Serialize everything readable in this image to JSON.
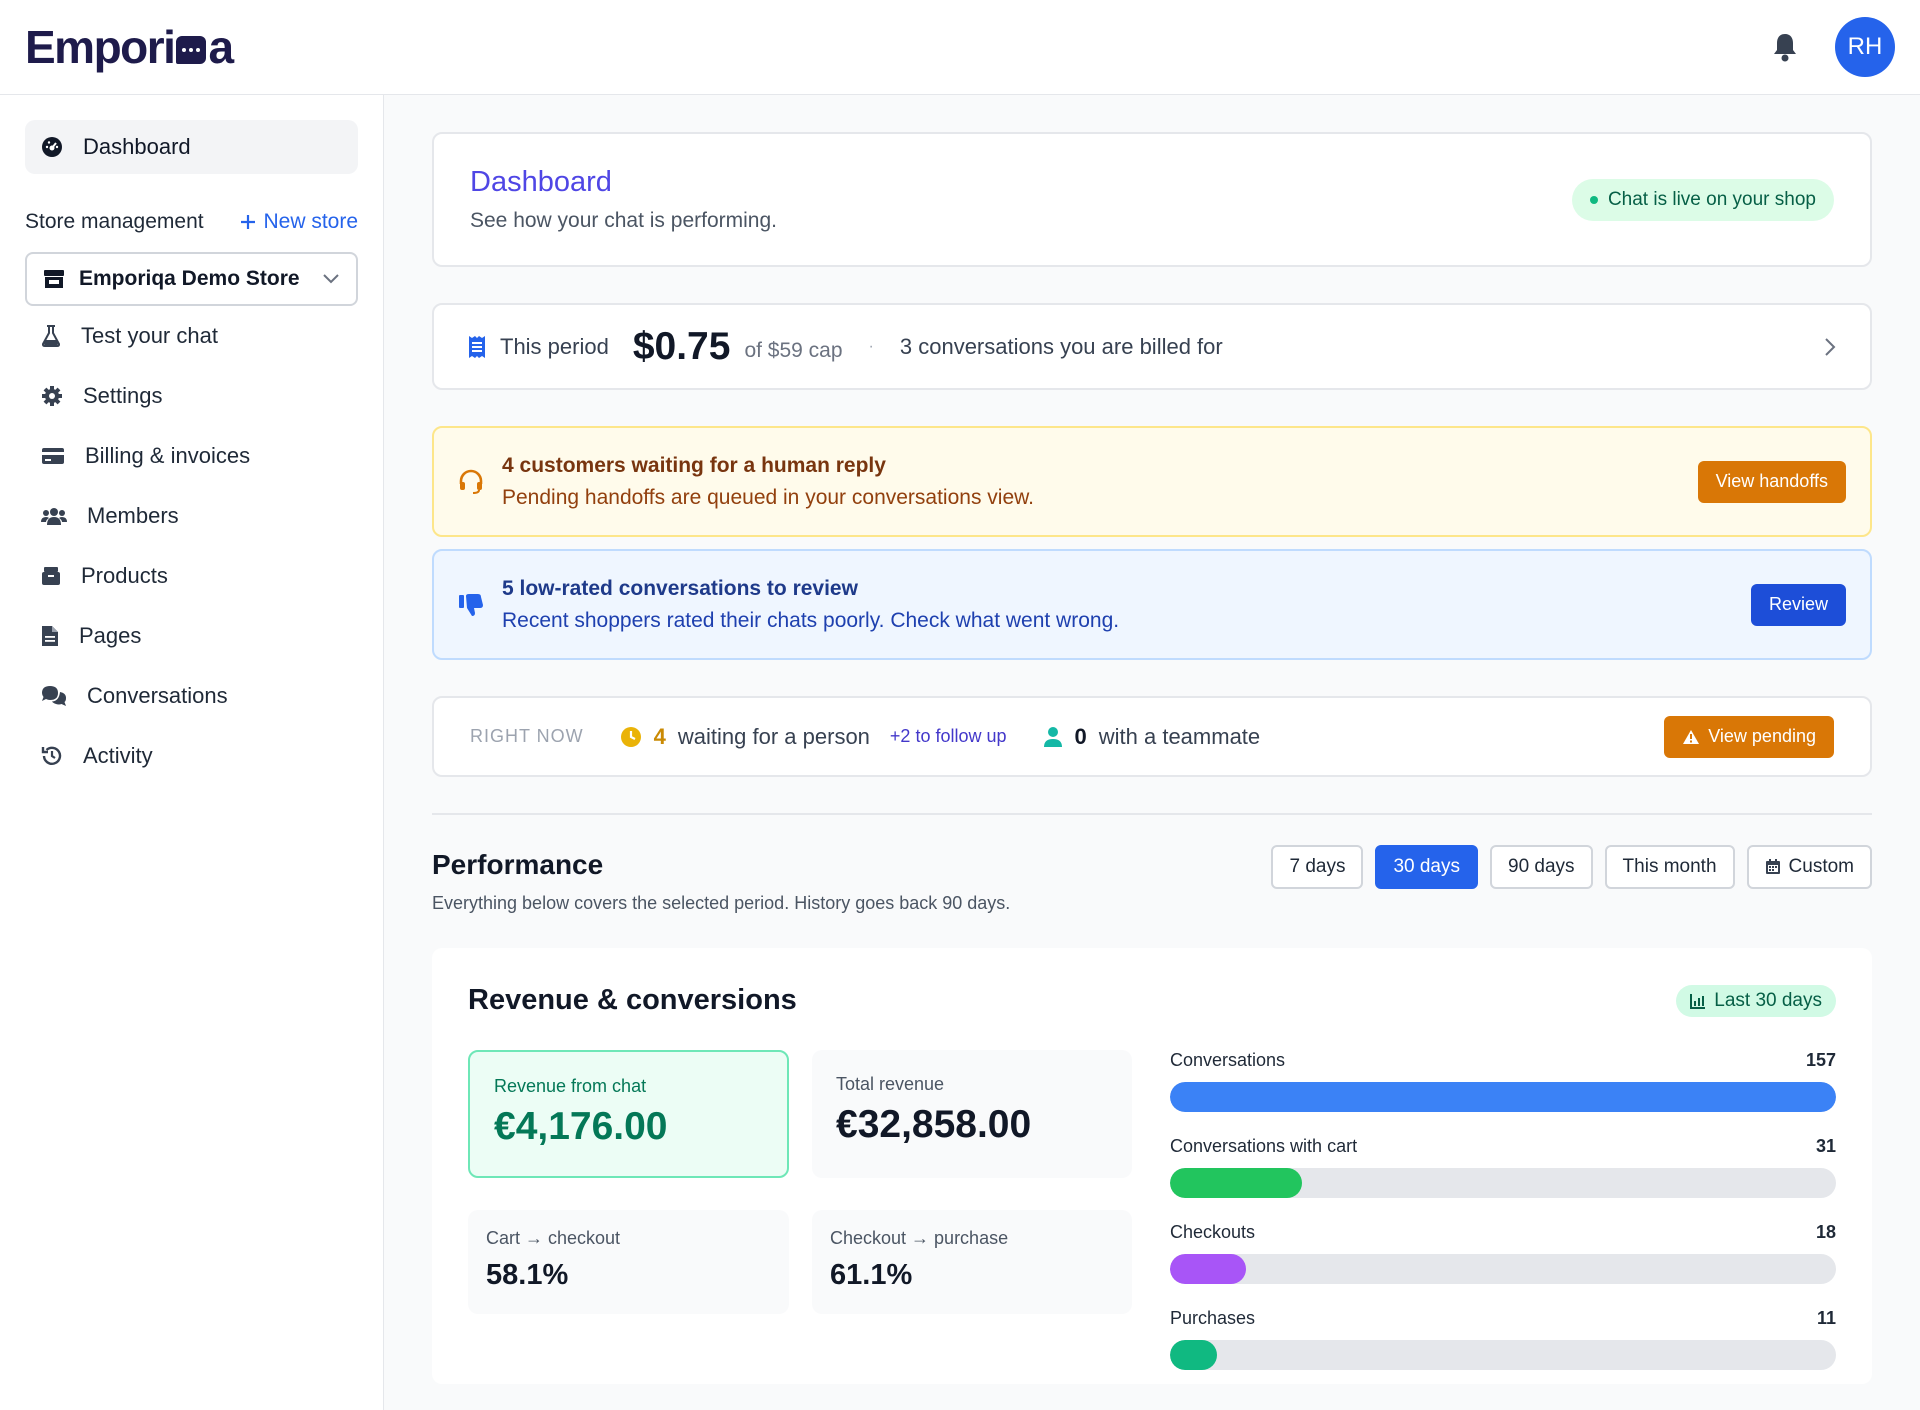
{
  "header": {
    "logo_left": "Empori",
    "logo_right": "a",
    "avatar_initials": "RH"
  },
  "sidebar": {
    "active_item": "Dashboard",
    "store_management_label": "Store management",
    "new_store_label": "New store",
    "store_selected": "Emporiqa Demo Store",
    "items": [
      {
        "label": "Test your chat",
        "icon": "flask-icon"
      },
      {
        "label": "Settings",
        "icon": "gear-icon"
      },
      {
        "label": "Billing & invoices",
        "icon": "credit-card-icon"
      },
      {
        "label": "Members",
        "icon": "users-icon"
      },
      {
        "label": "Products",
        "icon": "box-icon"
      },
      {
        "label": "Pages",
        "icon": "file-icon"
      },
      {
        "label": "Conversations",
        "icon": "comments-icon"
      },
      {
        "label": "Activity",
        "icon": "history-icon"
      }
    ]
  },
  "hero": {
    "title": "Dashboard",
    "subtitle": "See how your chat is performing.",
    "status": "Chat is live on your shop"
  },
  "billing": {
    "label": "This period",
    "amount": "$0.75",
    "cap": "of $59 cap",
    "separator": "·",
    "conversations": "3 conversations you are billed for"
  },
  "alerts": {
    "handoffs": {
      "title": "4 customers waiting for a human reply",
      "subtitle": "Pending handoffs are queued in your conversations view.",
      "button": "View handoffs"
    },
    "low_rated": {
      "title": "5 low-rated conversations to review",
      "subtitle": "Recent shoppers rated their chats poorly. Check what went wrong.",
      "button": "Review"
    }
  },
  "right_now": {
    "label": "RIGHT NOW",
    "waiting_count": "4",
    "waiting_text": "waiting for a person",
    "follow_up": "+2 to follow up",
    "teammate_count": "0",
    "teammate_text": "with a teammate",
    "button": "View pending"
  },
  "performance": {
    "title": "Performance",
    "subtitle": "Everything below covers the selected period. History goes back 90 days.",
    "ranges": [
      "7 days",
      "30 days",
      "90 days",
      "This month",
      "Custom"
    ],
    "active_range": "30 days"
  },
  "revenue": {
    "title": "Revenue & conversions",
    "period": "Last 30 days",
    "revenue_from_chat_label": "Revenue from chat",
    "revenue_from_chat": "€4,176.00",
    "total_revenue_label": "Total revenue",
    "total_revenue": "€32,858.00",
    "cart_checkout_label": "Cart → checkout",
    "cart_checkout": "58.1%",
    "checkout_purchase_label": "Checkout → purchase",
    "checkout_purchase": "61.1%"
  },
  "funnel": [
    {
      "label": "Conversations",
      "value": "157",
      "count": 157,
      "color": "#3b82f6"
    },
    {
      "label": "Conversations with cart",
      "value": "31",
      "count": 31,
      "color": "#22c55e"
    },
    {
      "label": "Checkouts",
      "value": "18",
      "count": 18,
      "color": "#a855f7"
    },
    {
      "label": "Purchases",
      "value": "11",
      "count": 11,
      "color": "#10b981"
    }
  ],
  "colors": {
    "accent": "#2563eb",
    "brand": "#1e1b4b",
    "warning": "#d97706",
    "success": "#047857"
  }
}
